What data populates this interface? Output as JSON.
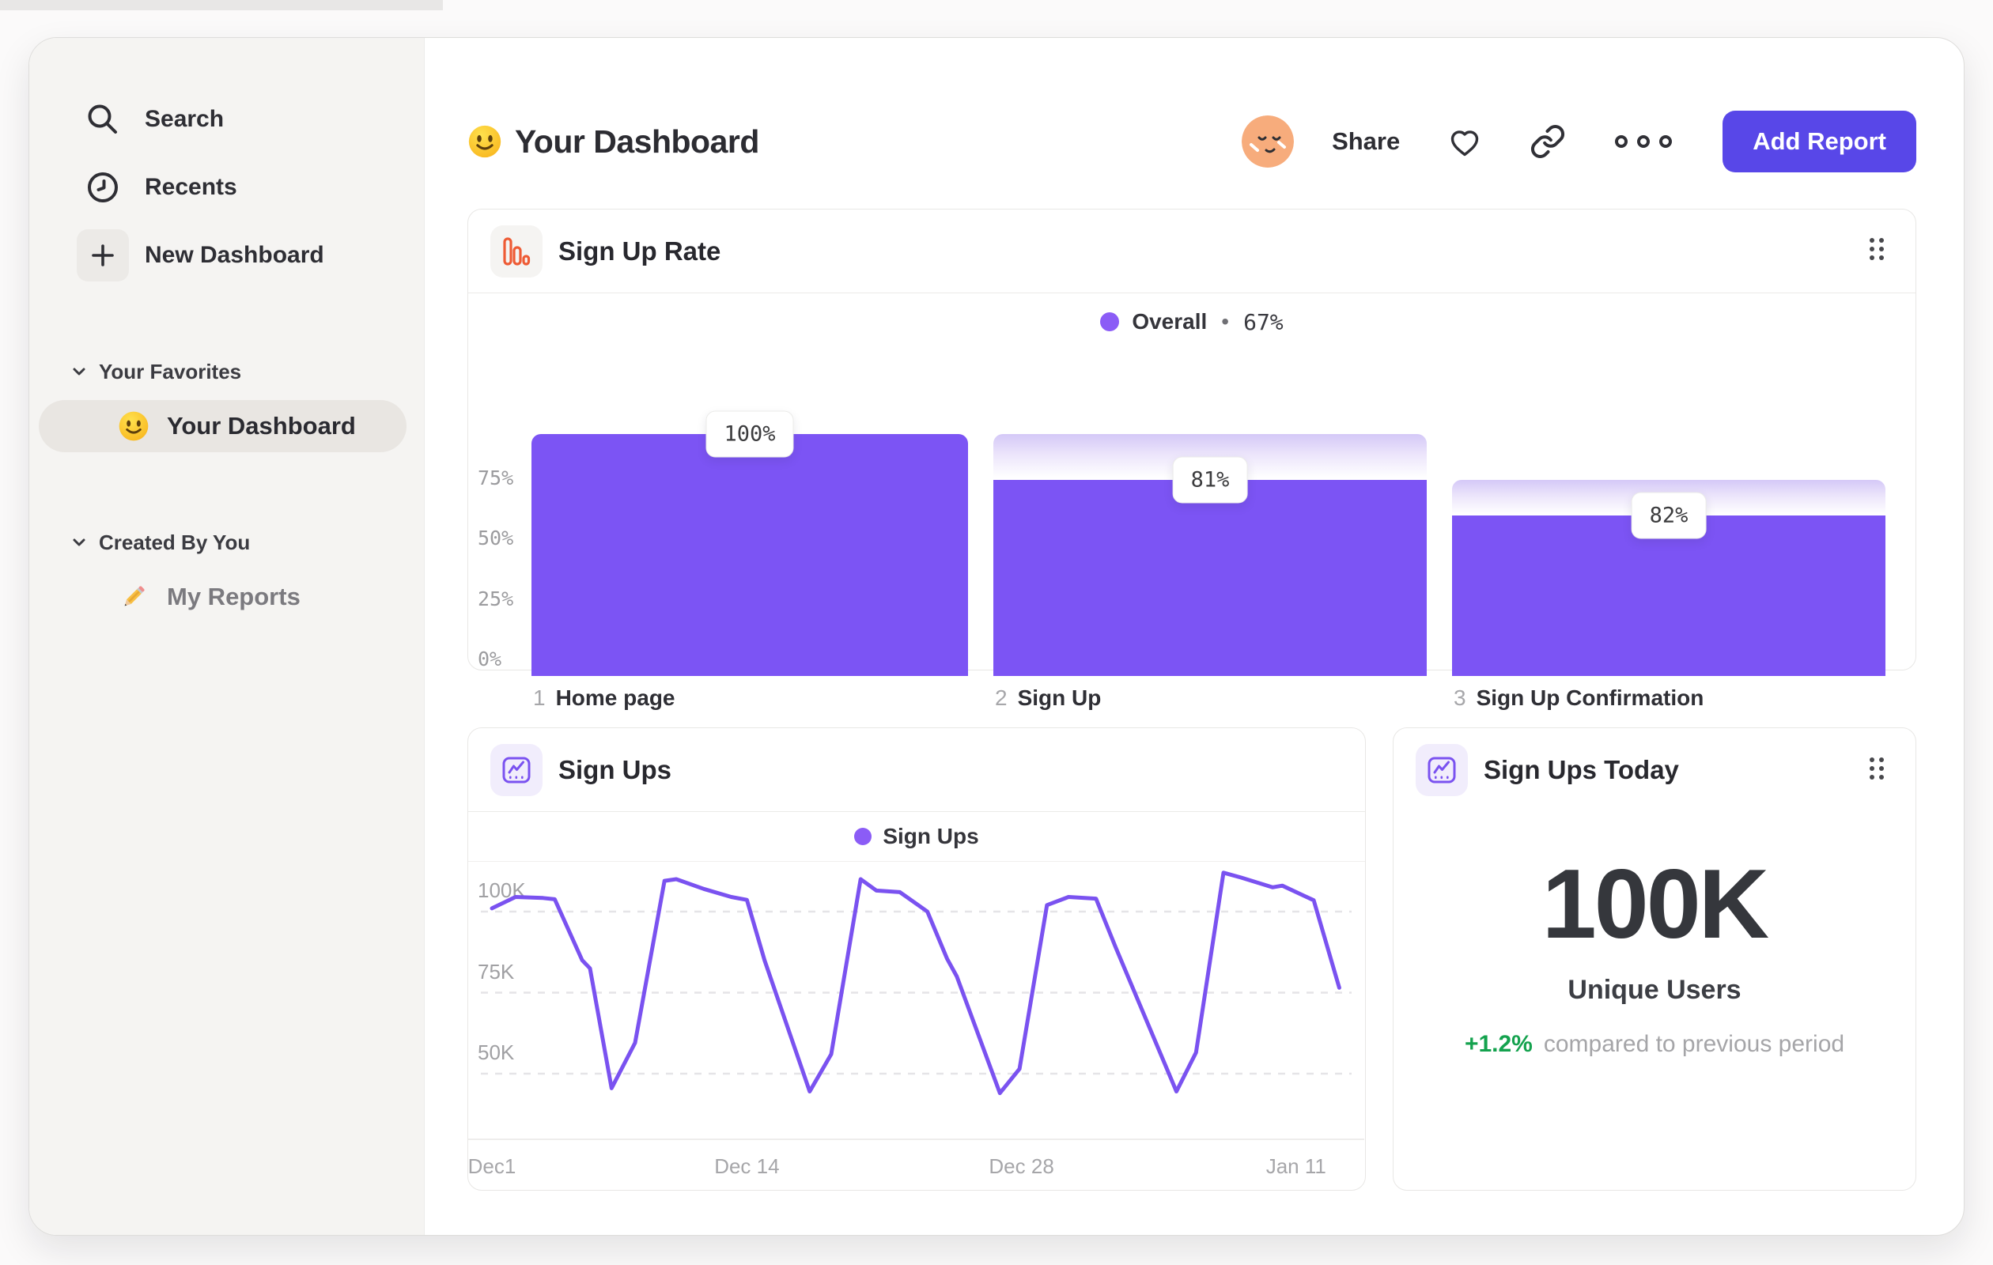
{
  "colors": {
    "accent_button": "#5847E8",
    "funnel_bar": "#7C54F4",
    "line_stroke": "#7A52F0",
    "legend_dot": "#8B5CF6",
    "funnel_icon_orange": "#EE5B35",
    "delta_green": "#14A24E"
  },
  "sidebar": {
    "primary": [
      {
        "icon": "search-icon",
        "label": "Search"
      },
      {
        "icon": "clock-icon",
        "label": "Recents"
      },
      {
        "icon": "plus-icon",
        "label": "New Dashboard"
      }
    ],
    "sections": [
      {
        "label": "Your Favorites",
        "items": [
          {
            "icon": "smiley-emoji",
            "label": "Your Dashboard",
            "active": true
          }
        ]
      },
      {
        "label": "Created By You",
        "items": [
          {
            "icon": "pencil-emoji",
            "label": "My Reports",
            "active": false
          }
        ]
      }
    ]
  },
  "header": {
    "emoji_icon": "smiley-emoji",
    "title": "Your Dashboard",
    "share_label": "Share",
    "actions": [
      "favorite-heart-icon",
      "copy-link-icon",
      "more-ellipsis-icon"
    ],
    "add_report_label": "Add Report"
  },
  "chart_data": [
    {
      "id": "sign_up_rate",
      "type": "bar",
      "title": "Sign Up Rate",
      "legend": {
        "series": "Overall",
        "separator": "•",
        "value": "67%"
      },
      "ylabel": "",
      "xlabel": "",
      "ylim": [
        0,
        100
      ],
      "y_ticks": [
        {
          "label": "75%",
          "pct": 75
        },
        {
          "label": "50%",
          "pct": 50
        },
        {
          "label": "25%",
          "pct": 25
        },
        {
          "label": "0%",
          "pct": 0
        }
      ],
      "steps": [
        {
          "num": "1",
          "label": "Home page",
          "value_label": "100%",
          "total_pct": 100,
          "pct_of_total": 100
        },
        {
          "num": "2",
          "label": "Sign Up",
          "value_label": "81%",
          "total_pct": 100,
          "pct_of_total": 81
        },
        {
          "num": "3",
          "label": "Sign Up Confirmation",
          "value_label": "82%",
          "total_pct": 81,
          "pct_of_total": 66.4
        }
      ]
    },
    {
      "id": "sign_ups",
      "type": "line",
      "title": "Sign Ups",
      "legend": {
        "series": "Sign Ups"
      },
      "ylim_k": [
        30,
        112
      ],
      "grid": "dashed-horizontal",
      "y_ticks": [
        {
          "label": "100K",
          "value": 100
        },
        {
          "label": "75K",
          "value": 75
        },
        {
          "label": "50K",
          "value": 50
        }
      ],
      "x_ticks": [
        {
          "label": "Dec1",
          "day": 0
        },
        {
          "label": "Dec 14",
          "day": 13
        },
        {
          "label": "Dec 28",
          "day": 27
        },
        {
          "label": "Jan 11",
          "day": 41
        }
      ],
      "points_day_valueK": [
        [
          0,
          101
        ],
        [
          1.2,
          104.5
        ],
        [
          2.6,
          104.2
        ],
        [
          3.2,
          103.8
        ],
        [
          4.6,
          85
        ],
        [
          5,
          82.5
        ],
        [
          6.1,
          45.5
        ],
        [
          7.3,
          59.5
        ],
        [
          8.8,
          109.5
        ],
        [
          9.4,
          110
        ],
        [
          10.8,
          107
        ],
        [
          12.2,
          104.5
        ],
        [
          13,
          103.6
        ],
        [
          13.9,
          85
        ],
        [
          16.2,
          44.5
        ],
        [
          17.3,
          56
        ],
        [
          18.8,
          110
        ],
        [
          19.6,
          106.5
        ],
        [
          20.8,
          106
        ],
        [
          22.2,
          100
        ],
        [
          23.2,
          85.5
        ],
        [
          23.7,
          80
        ],
        [
          25.9,
          44
        ],
        [
          26.9,
          51.5
        ],
        [
          28.3,
          102
        ],
        [
          29.4,
          104.5
        ],
        [
          30.8,
          104
        ],
        [
          31.8,
          89
        ],
        [
          34.9,
          44.5
        ],
        [
          35.9,
          56.5
        ],
        [
          37.3,
          112
        ],
        [
          38.2,
          110.5
        ],
        [
          39.8,
          107.5
        ],
        [
          40.3,
          108
        ],
        [
          41.9,
          103.5
        ],
        [
          43.2,
          76.5
        ]
      ]
    },
    {
      "id": "sign_ups_today",
      "type": "metric",
      "title": "Sign Ups Today",
      "value": "100K",
      "label": "Unique Users",
      "delta": "+1.2%",
      "delta_note": "compared to previous period"
    }
  ]
}
